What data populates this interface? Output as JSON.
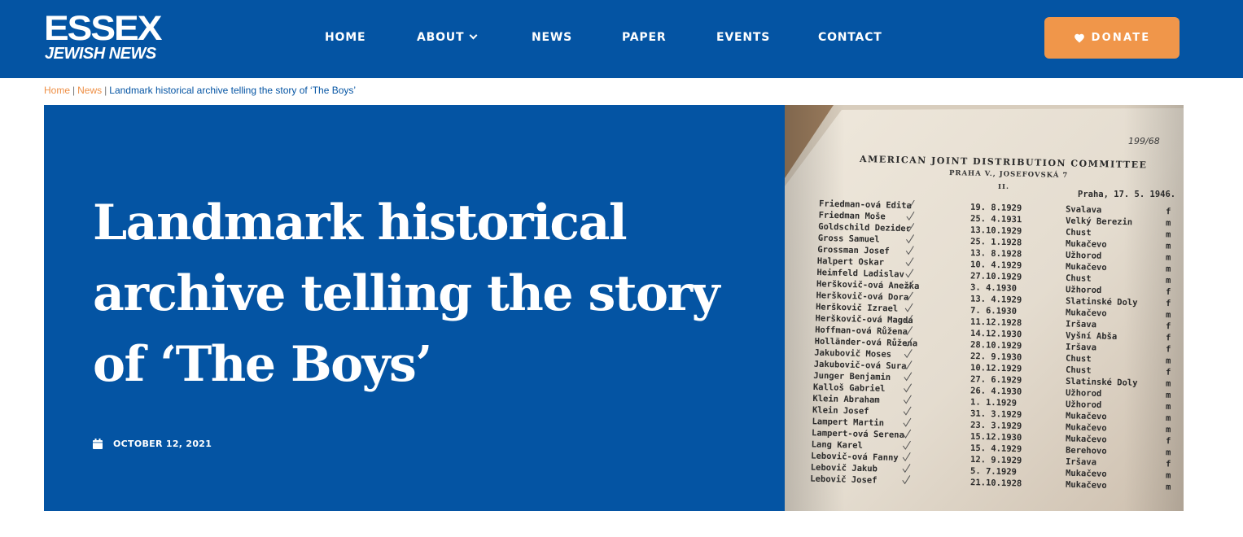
{
  "site": {
    "logo_line1": "ESSEX",
    "logo_line2": "JEWISH NEWS"
  },
  "nav": {
    "items": [
      {
        "label": "HOME"
      },
      {
        "label": "ABOUT"
      },
      {
        "label": "NEWS"
      },
      {
        "label": "PAPER"
      },
      {
        "label": "EVENTS"
      },
      {
        "label": "CONTACT"
      }
    ],
    "donate_label": "DONATE"
  },
  "breadcrumb": {
    "home": "Home",
    "news": "News",
    "current": "Landmark historical archive telling the story of ‘The Boys’"
  },
  "article": {
    "title": "Landmark historical archive telling the story of ‘The Boys’",
    "date": "OCTOBER 12, 2021"
  },
  "document": {
    "handwritten_ref": "199/68",
    "heading": "AMERICAN JOINT DISTRIBUTION COMMITTEE",
    "address": "PRAHA V., JOSEFOVSKÁ 7",
    "page": "II.",
    "place_date": "Praha, 17. 5. 1946.",
    "rows": [
      {
        "name": "Friedman-ová Edita",
        "date": "19. 8.1929",
        "place": "Svalava",
        "sex": "f"
      },
      {
        "name": "Friedman Moše",
        "date": "25. 4.1931",
        "place": "Velký Berezin",
        "sex": "m"
      },
      {
        "name": "Goldschild Dezider",
        "date": "13.10.1929",
        "place": "Chust",
        "sex": "m"
      },
      {
        "name": "Gross Samuel",
        "date": "25. 1.1928",
        "place": "Mukačevo",
        "sex": "m"
      },
      {
        "name": "Grossman Josef",
        "date": "13. 8.1928",
        "place": "Užhorod",
        "sex": "m"
      },
      {
        "name": "Halpert Oskar",
        "date": "10. 4.1929",
        "place": "Mukačevo",
        "sex": "m"
      },
      {
        "name": "Heimfeld Ladislav",
        "date": "27.10.1929",
        "place": "Chust",
        "sex": "m"
      },
      {
        "name": "Herškovič-ová Anežka",
        "date": "3. 4.1930",
        "place": "Užhorod",
        "sex": "f"
      },
      {
        "name": "Herškovič-ová Dora",
        "date": "13. 4.1929",
        "place": "Slatinské Doly",
        "sex": "f"
      },
      {
        "name": "Herškovič Izrael",
        "date": "7. 6.1930",
        "place": "Mukačevo",
        "sex": "m"
      },
      {
        "name": "Herškovič-ová Magda",
        "date": "11.12.1928",
        "place": "Iršava",
        "sex": "f"
      },
      {
        "name": "Hoffman-ová Růžena",
        "date": "14.12.1930",
        "place": "Vyšní Abša",
        "sex": "f"
      },
      {
        "name": "Holländer-ová Růžena",
        "date": "28.10.1929",
        "place": "Iršava",
        "sex": "f"
      },
      {
        "name": "Jakubovič Moses",
        "date": "22. 9.1930",
        "place": "Chust",
        "sex": "m"
      },
      {
        "name": "Jakubovič-ová Sura",
        "date": "10.12.1929",
        "place": "Chust",
        "sex": "f"
      },
      {
        "name": "Junger Benjamin",
        "date": "27. 6.1929",
        "place": "Slatinské Doly",
        "sex": "m"
      },
      {
        "name": "Kalloš Gabriel",
        "date": "26. 4.1930",
        "place": "Užhorod",
        "sex": "m"
      },
      {
        "name": "Klein Abraham",
        "date": "1. 1.1929",
        "place": "Užhorod",
        "sex": "m"
      },
      {
        "name": "Klein Josef",
        "date": "31. 3.1929",
        "place": "Mukačevo",
        "sex": "m"
      },
      {
        "name": "Lampert Martin",
        "date": "23. 3.1929",
        "place": "Mukačevo",
        "sex": "m"
      },
      {
        "name": "Lampert-ová Serena",
        "date": "15.12.1930",
        "place": "Mukačevo",
        "sex": "f"
      },
      {
        "name": "Lang Karel",
        "date": "15. 4.1929",
        "place": "Berehovo",
        "sex": "m"
      },
      {
        "name": "Lebovič-ová Fanny",
        "date": "12. 9.1929",
        "place": "Iršava",
        "sex": "f"
      },
      {
        "name": "Lebovič Jakub",
        "date": "5. 7.1929",
        "place": "Mukačevo",
        "sex": "m"
      },
      {
        "name": "Lebovič Josef",
        "date": "21.10.1928",
        "place": "Mukačevo",
        "sex": "m"
      }
    ]
  },
  "colors": {
    "brand_blue": "#0454a3",
    "accent_orange": "#f0964a",
    "breadcrumb_link": "#ee8f45"
  }
}
